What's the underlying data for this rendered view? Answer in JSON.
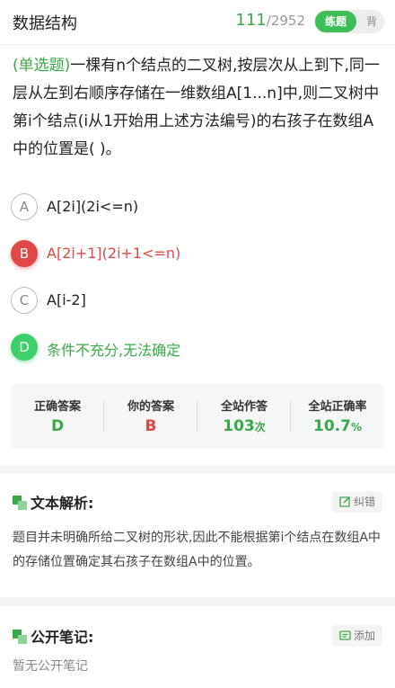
{
  "header": {
    "title": "数据结构",
    "current": "111",
    "total": "/2952",
    "mode_active": "练题",
    "mode_inactive": "背"
  },
  "question": {
    "type": "(单选题)",
    "text": "一棵有n个结点的二叉树,按层次从上到下,同一层从左到右顺序存储在一维数组A[1...n]中,则二叉树中第i个结点(i从1开始用上述方法编号)的右孩子在数组A中的位置是(        )。"
  },
  "options": [
    {
      "letter": "A",
      "text": "A[2i](2i<=n)",
      "state": "normal"
    },
    {
      "letter": "B",
      "text": "A[2i+1](2i+1<=n)",
      "state": "wrong"
    },
    {
      "letter": "C",
      "text": "A[i-2]",
      "state": "normal"
    },
    {
      "letter": "D",
      "text": "条件不充分,无法确定",
      "state": "correct"
    }
  ],
  "stats": {
    "correct_label": "正确答案",
    "correct_value": "D",
    "yours_label": "你的答案",
    "yours_value": "B",
    "attempts_label": "全站作答",
    "attempts_value": "103",
    "attempts_unit": "次",
    "rate_label": "全站正确率",
    "rate_value": "10.7",
    "rate_unit": "%"
  },
  "analysis": {
    "title": "文本解析:",
    "report_label": "纠错",
    "text": "题目并未明确所给二叉树的形状,因此不能根据第i个结点在数组A中的存储位置确定其右孩子在数组A中的位置。"
  },
  "notes": {
    "title": "公开笔记:",
    "add_label": "添加",
    "empty_text": "暂无公开笔记"
  },
  "colors": {
    "accent_green": "#3aa84a",
    "wrong_red": "#e24747"
  },
  "icons": [
    "edit-icon",
    "note-icon",
    "section-marker-icon"
  ]
}
